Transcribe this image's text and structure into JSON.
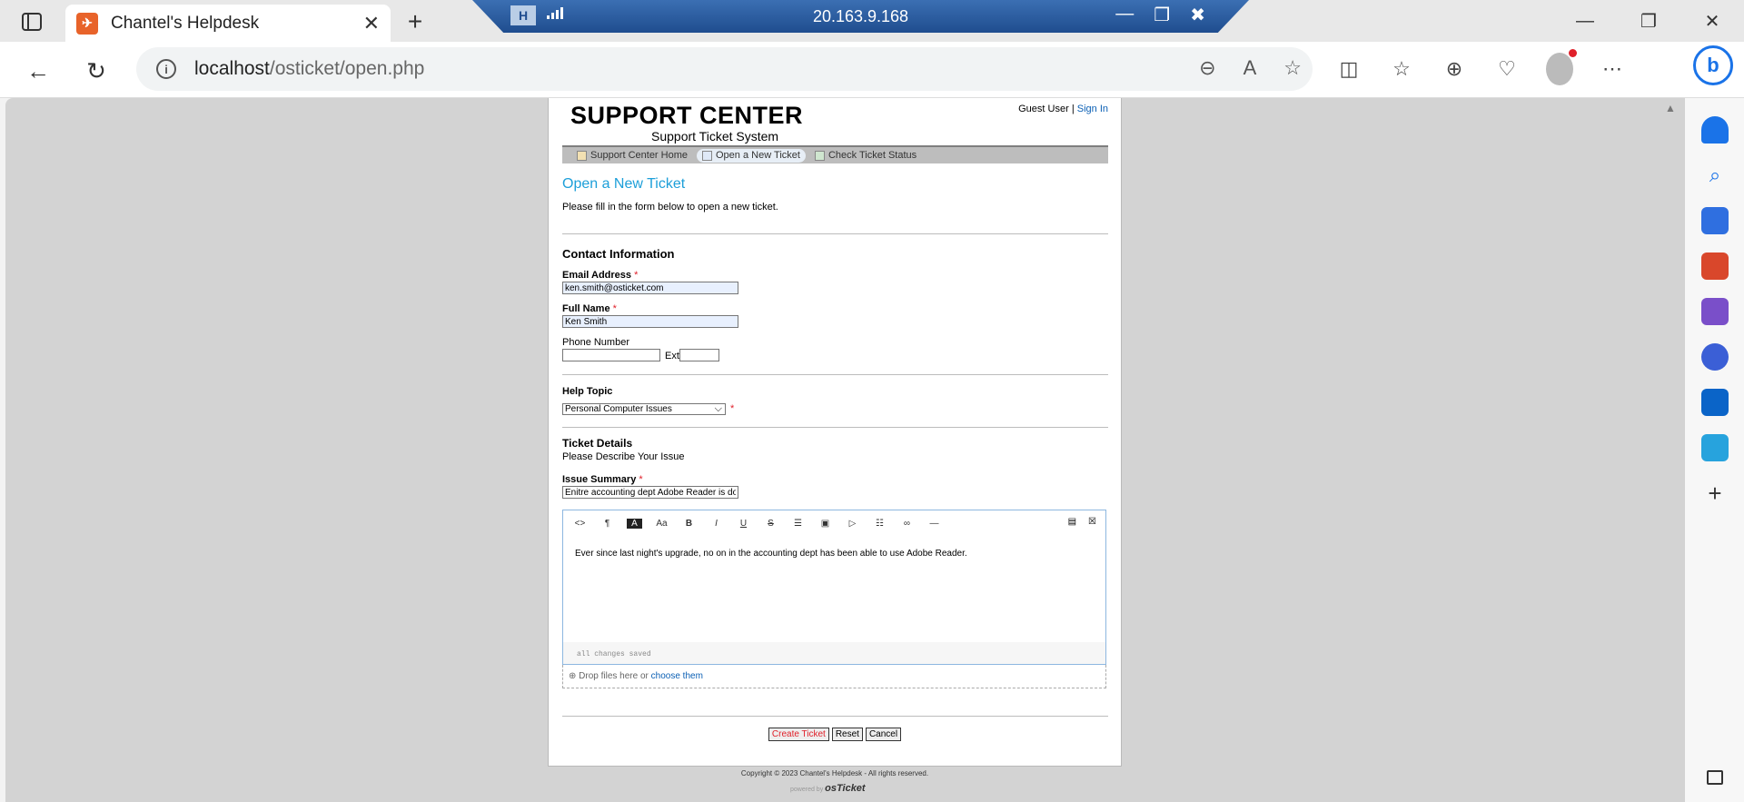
{
  "browser": {
    "tab_title": "Chantel's Helpdesk",
    "favicon": "kangaroo",
    "url_host": "localhost",
    "url_path": "/osticket/open.php",
    "remote_ip": "20.163.9.168"
  },
  "page": {
    "logo_title": "SUPPORT CENTER",
    "logo_subtitle": "Support Ticket System",
    "guest_user": "Guest User",
    "separator": "|",
    "sign_in": "Sign In",
    "nav": [
      {
        "label": "Support Center Home"
      },
      {
        "label": "Open a New Ticket"
      },
      {
        "label": "Check Ticket Status"
      }
    ],
    "heading": "Open a New Ticket",
    "intro": "Please fill in the form below to open a new ticket.",
    "contact_heading": "Contact Information",
    "email_label": "Email Address",
    "email_value": "ken.smith@osticket.com",
    "name_label": "Full Name",
    "name_value": "Ken Smith",
    "phone_label": "Phone Number",
    "ext_label": "Ext:",
    "help_topic_label": "Help Topic",
    "help_topic_value": "Personal Computer Issues",
    "ticket_heading": "Ticket Details",
    "ticket_sub": "Please Describe Your Issue",
    "summary_label": "Issue Summary",
    "summary_value": "Enitre accounting dept Adobe Reader is down.",
    "editor_text": "Ever since last night's upgrade, no on in the accounting dept has been able to use Adobe Reader.",
    "editor_status": "all changes saved",
    "drop_text": "Drop files here or ",
    "drop_link": "choose them",
    "required_mark": "*",
    "btn_create": "Create Ticket",
    "btn_reset": "Reset",
    "btn_cancel": "Cancel",
    "copyright": "Copyright © 2023 Chantel's Helpdesk - All rights reserved.",
    "powered_by": "powered by",
    "powered_brand": "osTicket"
  }
}
